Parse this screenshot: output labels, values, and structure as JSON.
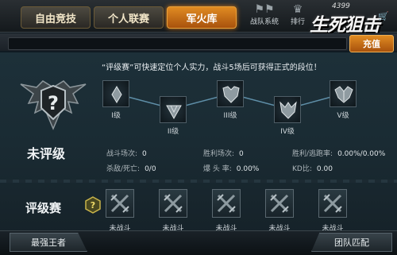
{
  "tabs": [
    {
      "label": "自由竞技",
      "active": false
    },
    {
      "label": "个人联赛",
      "active": false
    },
    {
      "label": "军火库",
      "active": true
    }
  ],
  "header": {
    "team_system_label": "战队系统",
    "rank_label": "排行",
    "logo_number": "4399",
    "logo_text": "生死狙击",
    "recharge_label": "充值"
  },
  "intro_text": "“评级赛”可快速定位个人实力，战斗5场后可获得正式的段位！",
  "tiers": [
    {
      "label": "I级"
    },
    {
      "label": "II级"
    },
    {
      "label": "III级"
    },
    {
      "label": "IV级"
    },
    {
      "label": "V级"
    }
  ],
  "status": {
    "title": "未评级",
    "emblem_symbol": "?"
  },
  "stats": [
    {
      "label": "战斗场次:",
      "value": "0"
    },
    {
      "label": "胜利场次:",
      "value": "0"
    },
    {
      "label": "胜利/逃跑率:",
      "value": "0.00%/0.00%"
    },
    {
      "label": "杀敌/死亡:",
      "value": "0/0"
    },
    {
      "label": "爆 头 率:",
      "value": "0.00%"
    },
    {
      "label": "KD比:",
      "value": "0.00"
    }
  ],
  "rated_match": {
    "title": "评级赛",
    "help_symbol": "?",
    "slots": [
      {
        "label": "未战斗"
      },
      {
        "label": "未战斗"
      },
      {
        "label": "未战斗"
      },
      {
        "label": "未战斗"
      },
      {
        "label": "未战斗"
      }
    ]
  },
  "footer": {
    "left_button": "最强王者",
    "right_button": "团队匹配"
  },
  "colors": {
    "accent_orange": "#e08b22",
    "panel_bg": "#1d3039",
    "line_blue": "#5f8fa8"
  }
}
